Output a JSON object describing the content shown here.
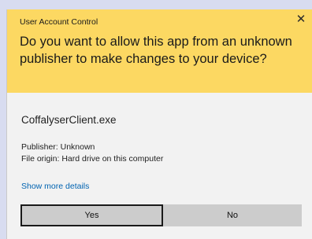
{
  "dialog": {
    "title": "User Account Control",
    "close_symbol": "✕",
    "question": "Do you want to allow this app from an unknown publisher to make changes to your device?",
    "app_name": "CoffalyserClient.exe",
    "publisher": "Publisher: Unknown",
    "file_origin": "File origin: Hard drive on this computer",
    "show_more_details": "Show more details",
    "yes_label": "Yes",
    "no_label": "No"
  },
  "colors": {
    "header_bg": "#fcd862",
    "body_bg": "#f2f2f2",
    "link": "#0063b1",
    "button_bg": "#cccccc"
  }
}
